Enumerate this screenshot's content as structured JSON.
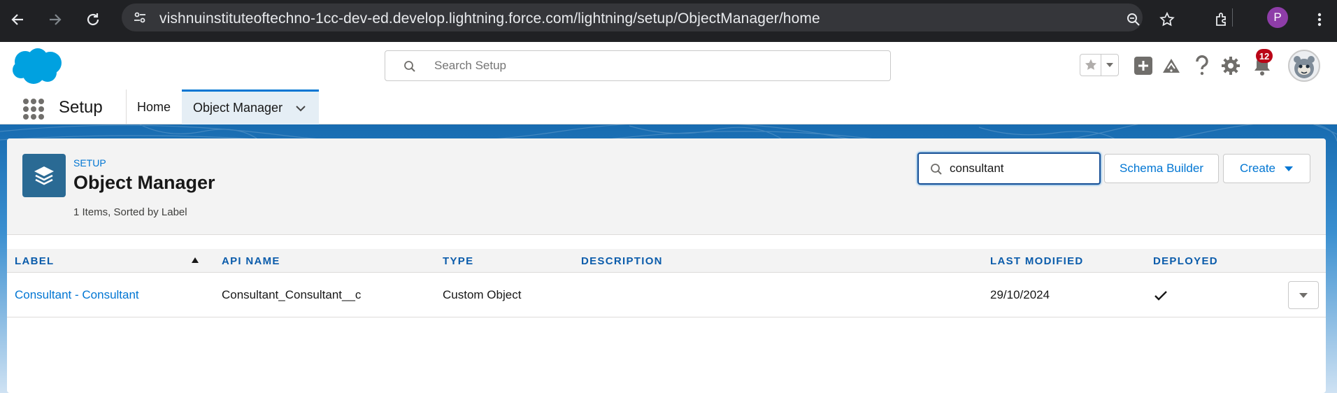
{
  "browser": {
    "url": "vishnuinstituteoftechno-1cc-dev-ed.develop.lightning.force.com/lightning/setup/ObjectManager/home",
    "profile_initial": "P"
  },
  "header": {
    "search_placeholder": "Search Setup",
    "notification_count": "12"
  },
  "nav": {
    "app_name": "Setup",
    "tabs": [
      {
        "label": "Home"
      },
      {
        "label": "Object Manager"
      }
    ]
  },
  "page": {
    "eyebrow": "SETUP",
    "title": "Object Manager",
    "meta": "1 Items, Sorted by Label",
    "search_value": "consultant",
    "schema_builder_label": "Schema Builder",
    "create_label": "Create"
  },
  "table": {
    "columns": [
      "LABEL",
      "API NAME",
      "TYPE",
      "DESCRIPTION",
      "LAST MODIFIED",
      "DEPLOYED"
    ],
    "rows": [
      {
        "label": "Consultant - Consultant",
        "api_name": "Consultant_Consultant__c",
        "type": "Custom Object",
        "description": "",
        "last_modified": "29/10/2024",
        "deployed": true
      }
    ]
  },
  "colors": {
    "brand_blue": "#0176d3",
    "header_link": "#0b5cab",
    "badge_red": "#ba0517",
    "object_icon_bg": "#2a6a94"
  }
}
